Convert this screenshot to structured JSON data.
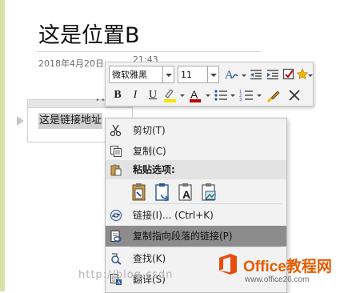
{
  "page": {
    "title": "这是位置B",
    "date": "2018年4月20日",
    "time": "21:43"
  },
  "note": {
    "text": "这是链接地址",
    "grip_dots": "•••"
  },
  "toolbar": {
    "font_name": "微软雅黑",
    "font_size": "11",
    "bold": "B",
    "italic": "I",
    "underline": "U",
    "font_color_letter": "A",
    "highlight_color": "#f5e400",
    "font_color": "#c00000"
  },
  "context_menu": {
    "items": [
      {
        "label": "剪切(T)",
        "icon": "scissors-icon"
      },
      {
        "label": "复制(C)",
        "icon": "copy-icon"
      },
      {
        "label": "粘贴选项:",
        "icon": "paste-icon"
      },
      {
        "label": "链接(I)... (Ctrl+K)",
        "icon": "link-icon"
      },
      {
        "label": "复制指向段落的链接(P)",
        "icon": "link-paragraph-icon"
      },
      {
        "label": "查找(K)",
        "icon": "find-icon"
      },
      {
        "label": "翻译(S)",
        "icon": "translate-icon"
      }
    ],
    "paste_option_icons": [
      "paste-keep-formatting-icon",
      "paste-merge-formatting-icon",
      "paste-text-only-icon",
      "paste-picture-icon"
    ]
  },
  "watermarks": {
    "url_fragment": "http://blog.csdn",
    "brand_name": "Office教程网",
    "brand_url": "www.office26.com"
  },
  "colors": {
    "highlight_row": "#8c8c8c",
    "brand_orange": "#e65c00",
    "menu_bg": "#f2f2f2"
  }
}
